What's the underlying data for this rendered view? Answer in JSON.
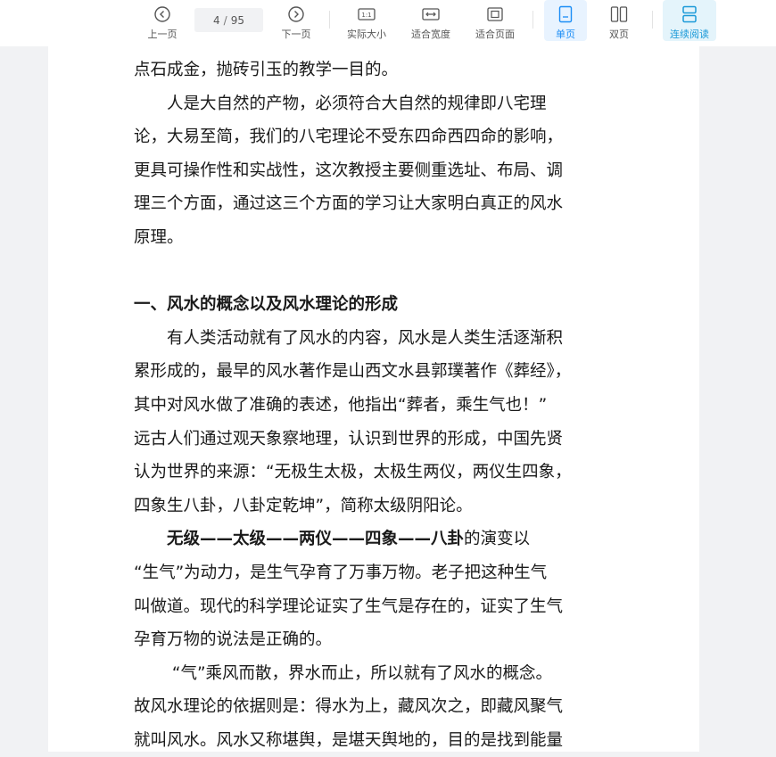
{
  "toolbar": {
    "prev_label": "上一页",
    "page_current": "4",
    "page_separator": "/",
    "page_total": "95",
    "next_label": "下一页",
    "actual_size_label": "实际大小",
    "fit_width_label": "适合宽度",
    "fit_page_label": "适合页面",
    "single_label": "单页",
    "double_label": "双页",
    "continuous_label": "连续阅读"
  },
  "colors": {
    "active_blue": "#1b8df6",
    "active_cyan": "#1a99d8",
    "background": "#f1f2f4"
  },
  "icons": {
    "prev": "circle-chevron-left-icon",
    "next": "circle-chevron-right-icon",
    "actual_size": "one-to-one-icon",
    "fit_width": "fit-width-icon",
    "fit_page": "fit-page-icon",
    "single": "single-page-icon",
    "double": "double-page-icon",
    "continuous": "continuous-scroll-icon"
  },
  "document": {
    "lines": [
      "点石成金，抛砖引玉的教学一目的。",
      "　　人是大自然的产物，必须符合大自然的规律即八宅理",
      "论，大易至简，我们的八宅理论不受东四命西四命的影响，",
      "更具可操作性和实战性，这次教授主要侧重选址、布局、调",
      "理三个方面，通过这三个方面的学习让大家明白真正的风水",
      "原理。",
      "一、风水的概念以及风水理论的形成",
      "　　有人类活动就有了风水的内容，风水是人类生活逐渐积",
      "累形成的，最早的风水著作是山西文水县郭璞著作《葬经》，",
      "其中对风水做了准确的表述，他指出“葬者，乘生气也！”",
      "远古人们通过观天象察地理，认识到世界的形成，中国先贤",
      "认为世界的来源：“无极生太极，太极生两仪，两仪生四象，",
      "四象生八卦，八卦定乾坤”，简称太级阴阳论。",
      "　　无级——太级——两仪——四象——八卦",
      "的演变以",
      "“生气”为动力，是生气孕育了万事万物。老子把这种生气",
      "叫做道。现代的科学理论证实了生气是存在的，证实了生气",
      "孕育万物的说法是正确的。",
      "　　 “气”乘风而散，界水而止，所以就有了风水的概念。",
      "故风水理论的依据则是：得水为上，藏风次之，即藏风聚气",
      "就叫风水。风水又称堪舆，是堪天舆地的，目的是找到能量"
    ]
  }
}
